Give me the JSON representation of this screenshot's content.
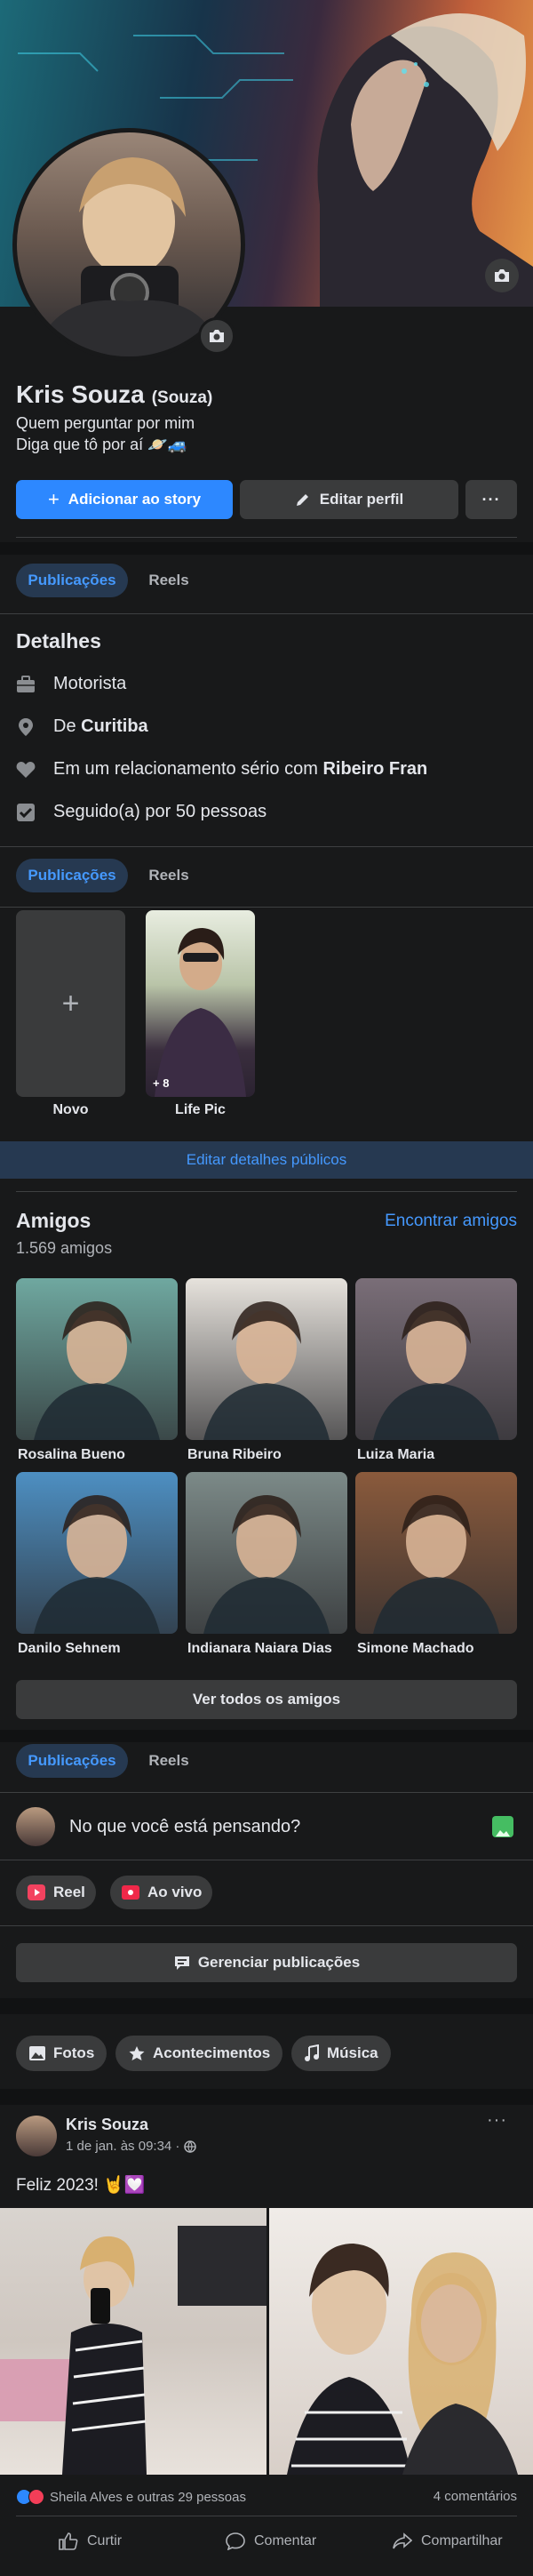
{
  "profile": {
    "name": "Kris Souza",
    "alt_name": "(Souza)",
    "bio_line1": "Quem perguntar por mim",
    "bio_line2": "Diga que tô por aí 🪐🚙"
  },
  "actions": {
    "add_story": "Adicionar ao story",
    "edit_profile": "Editar perfil",
    "more": "···"
  },
  "tabs": {
    "posts": "Publicações",
    "reels": "Reels"
  },
  "details": {
    "title": "Detalhes",
    "job": "Motorista",
    "from_prefix": "De ",
    "from_city": "Curitiba",
    "relationship_prefix": "Em um relacionamento sério com ",
    "relationship_partner": "Ribeiro Fran",
    "followers": "Seguido(a) por 50 pessoas"
  },
  "featured": {
    "new_label": "Novo",
    "album_label": "Life Pic",
    "album_count": "+ 8",
    "edit_public": "Editar detalhes públicos"
  },
  "friends": {
    "title": "Amigos",
    "count": "1.569 amigos",
    "find": "Encontrar amigos",
    "see_all": "Ver todos os amigos",
    "list": [
      {
        "name": "Rosalina Bueno",
        "color": "#6fa8a0"
      },
      {
        "name": "Bruna Ribeiro",
        "color": "#e6e2dc"
      },
      {
        "name": "Luiza Maria",
        "color": "#7a6e78"
      },
      {
        "name": "Danilo Sehnem",
        "color": "#4d8fc2"
      },
      {
        "name": "Indianara Naiara Dias",
        "color": "#7c8a88"
      },
      {
        "name": "Simone Machado",
        "color": "#8a5a3c"
      }
    ]
  },
  "composer": {
    "placeholder": "No que você está pensando?",
    "reel": "Reel",
    "live": "Ao vivo",
    "manage": "Gerenciar publicações"
  },
  "filters": {
    "photos": "Fotos",
    "events": "Acontecimentos",
    "music": "Música"
  },
  "post": {
    "author": "Kris Souza",
    "time": "1 de jan. às 09:34 · ",
    "text": "Feliz 2023! 🤘💟",
    "reactions": "Sheila Alves e outras 29 pessoas",
    "comments": "4 comentários",
    "like": "Curtir",
    "comment": "Comentar",
    "share": "Compartilhar"
  },
  "colors": {
    "accent": "#2d88ff",
    "link": "#4599ff"
  }
}
